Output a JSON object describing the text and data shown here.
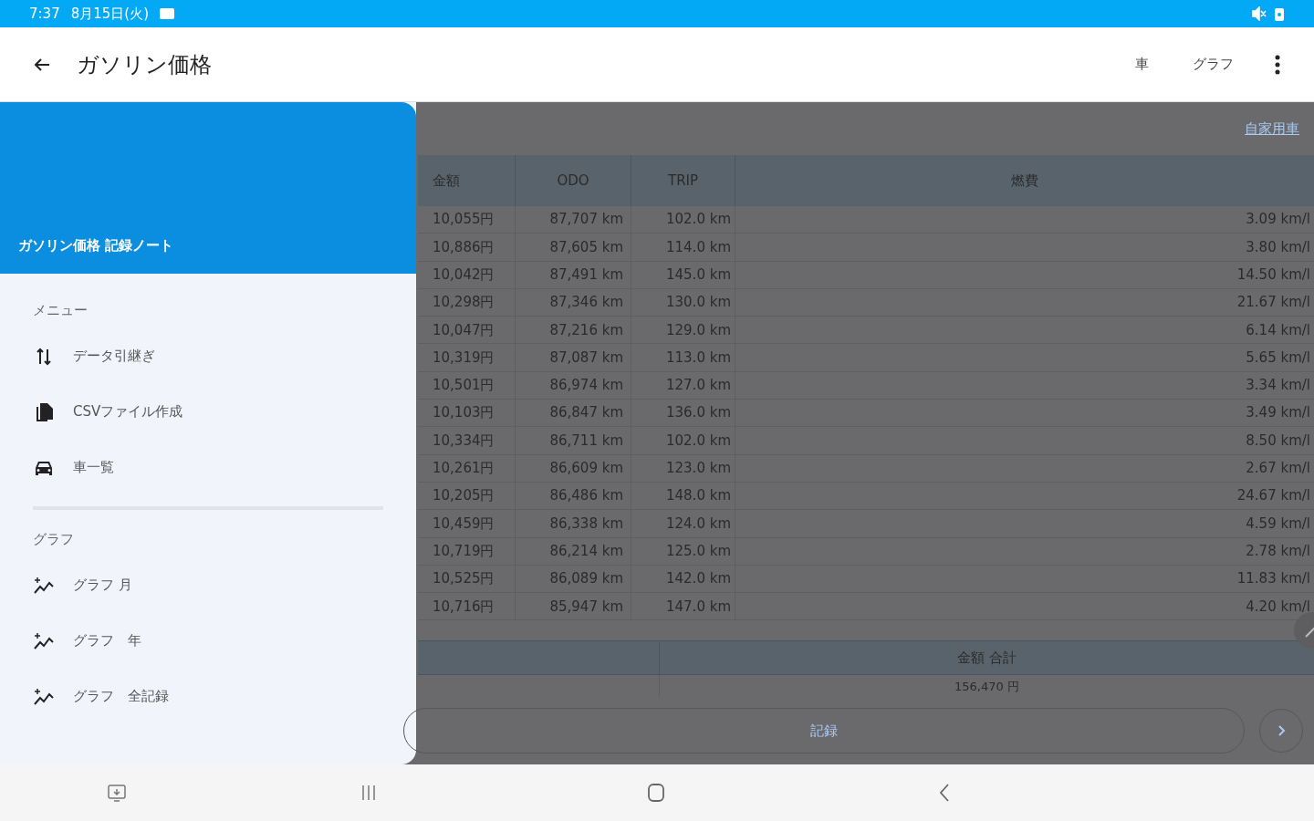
{
  "status_bar": {
    "time": "7:37",
    "date": "8月15日(火)"
  },
  "app_bar": {
    "title": "ガソリン価格",
    "actions": [
      "車",
      "グラフ"
    ]
  },
  "drawer": {
    "title": "ガソリン価格 記録ノート",
    "sections": [
      {
        "heading": "メニュー",
        "items": [
          {
            "label": "データ引継ぎ",
            "kind": "transfer"
          },
          {
            "label": "CSVファイル作成",
            "kind": "file"
          },
          {
            "label": "車一覧",
            "kind": "car"
          }
        ]
      },
      {
        "heading": "グラフ",
        "items": [
          {
            "label": "グラフ 月",
            "kind": "chart"
          },
          {
            "label": "グラフ　年",
            "kind": "chart"
          },
          {
            "label": "グラフ　全記録",
            "kind": "chart"
          }
        ]
      }
    ]
  },
  "car_link": "自家用車",
  "table": {
    "columns": [
      "金額",
      "ODO",
      "TRIP",
      "燃費"
    ],
    "rows": [
      [
        "10,055円",
        "87,707 km",
        "102.0 km",
        "3.09 km/l"
      ],
      [
        "10,886円",
        "87,605 km",
        "114.0 km",
        "3.80 km/l"
      ],
      [
        "10,042円",
        "87,491 km",
        "145.0 km",
        "14.50 km/l"
      ],
      [
        "10,298円",
        "87,346 km",
        "130.0 km",
        "21.67 km/l"
      ],
      [
        "10,047円",
        "87,216 km",
        "129.0 km",
        "6.14 km/l"
      ],
      [
        "10,319円",
        "87,087 km",
        "113.0 km",
        "5.65 km/l"
      ],
      [
        "10,501円",
        "86,974 km",
        "127.0 km",
        "3.34 km/l"
      ],
      [
        "10,103円",
        "86,847 km",
        "136.0 km",
        "3.49 km/l"
      ],
      [
        "10,334円",
        "86,711 km",
        "102.0 km",
        "8.50 km/l"
      ],
      [
        "10,261円",
        "86,609 km",
        "123.0 km",
        "2.67 km/l"
      ],
      [
        "10,205円",
        "86,486 km",
        "148.0 km",
        "24.67 km/l"
      ],
      [
        "10,459円",
        "86,338 km",
        "124.0 km",
        "4.59 km/l"
      ],
      [
        "10,719円",
        "86,214 km",
        "125.0 km",
        "2.78 km/l"
      ],
      [
        "10,525円",
        "86,089 km",
        "142.0 km",
        "11.83 km/l"
      ],
      [
        "10,716円",
        "85,947 km",
        "147.0 km",
        "4.20 km/l"
      ]
    ]
  },
  "summary": {
    "heading": "金額 合計",
    "value": "156,470 円"
  },
  "record_button": "記録"
}
